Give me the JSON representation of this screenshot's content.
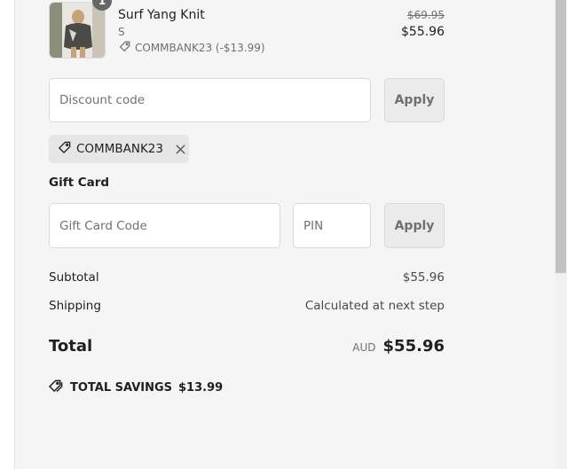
{
  "product": {
    "quantity": "1",
    "name": "Surf Yang Knit",
    "variant": "S",
    "discount_line": "COMMBANK23 (-$13.99)",
    "original_price": "$69.95",
    "price": "$55.96"
  },
  "discount": {
    "placeholder": "Discount code",
    "apply_label": "Apply",
    "applied_code": "COMMBANK23"
  },
  "gift_card": {
    "heading": "Gift Card",
    "code_placeholder": "Gift Card Code",
    "pin_placeholder": "PIN",
    "apply_label": "Apply"
  },
  "summary": {
    "subtotal_label": "Subtotal",
    "subtotal_value": "$55.96",
    "shipping_label": "Shipping",
    "shipping_value": "Calculated at next step",
    "total_label": "Total",
    "currency": "AUD",
    "total_value": "$55.96"
  },
  "savings": {
    "label": "TOTAL SAVINGS",
    "value": "$13.99"
  },
  "icons": {
    "tag": "tag-icon",
    "close": "close-icon",
    "savings": "savings-tag-icon"
  }
}
